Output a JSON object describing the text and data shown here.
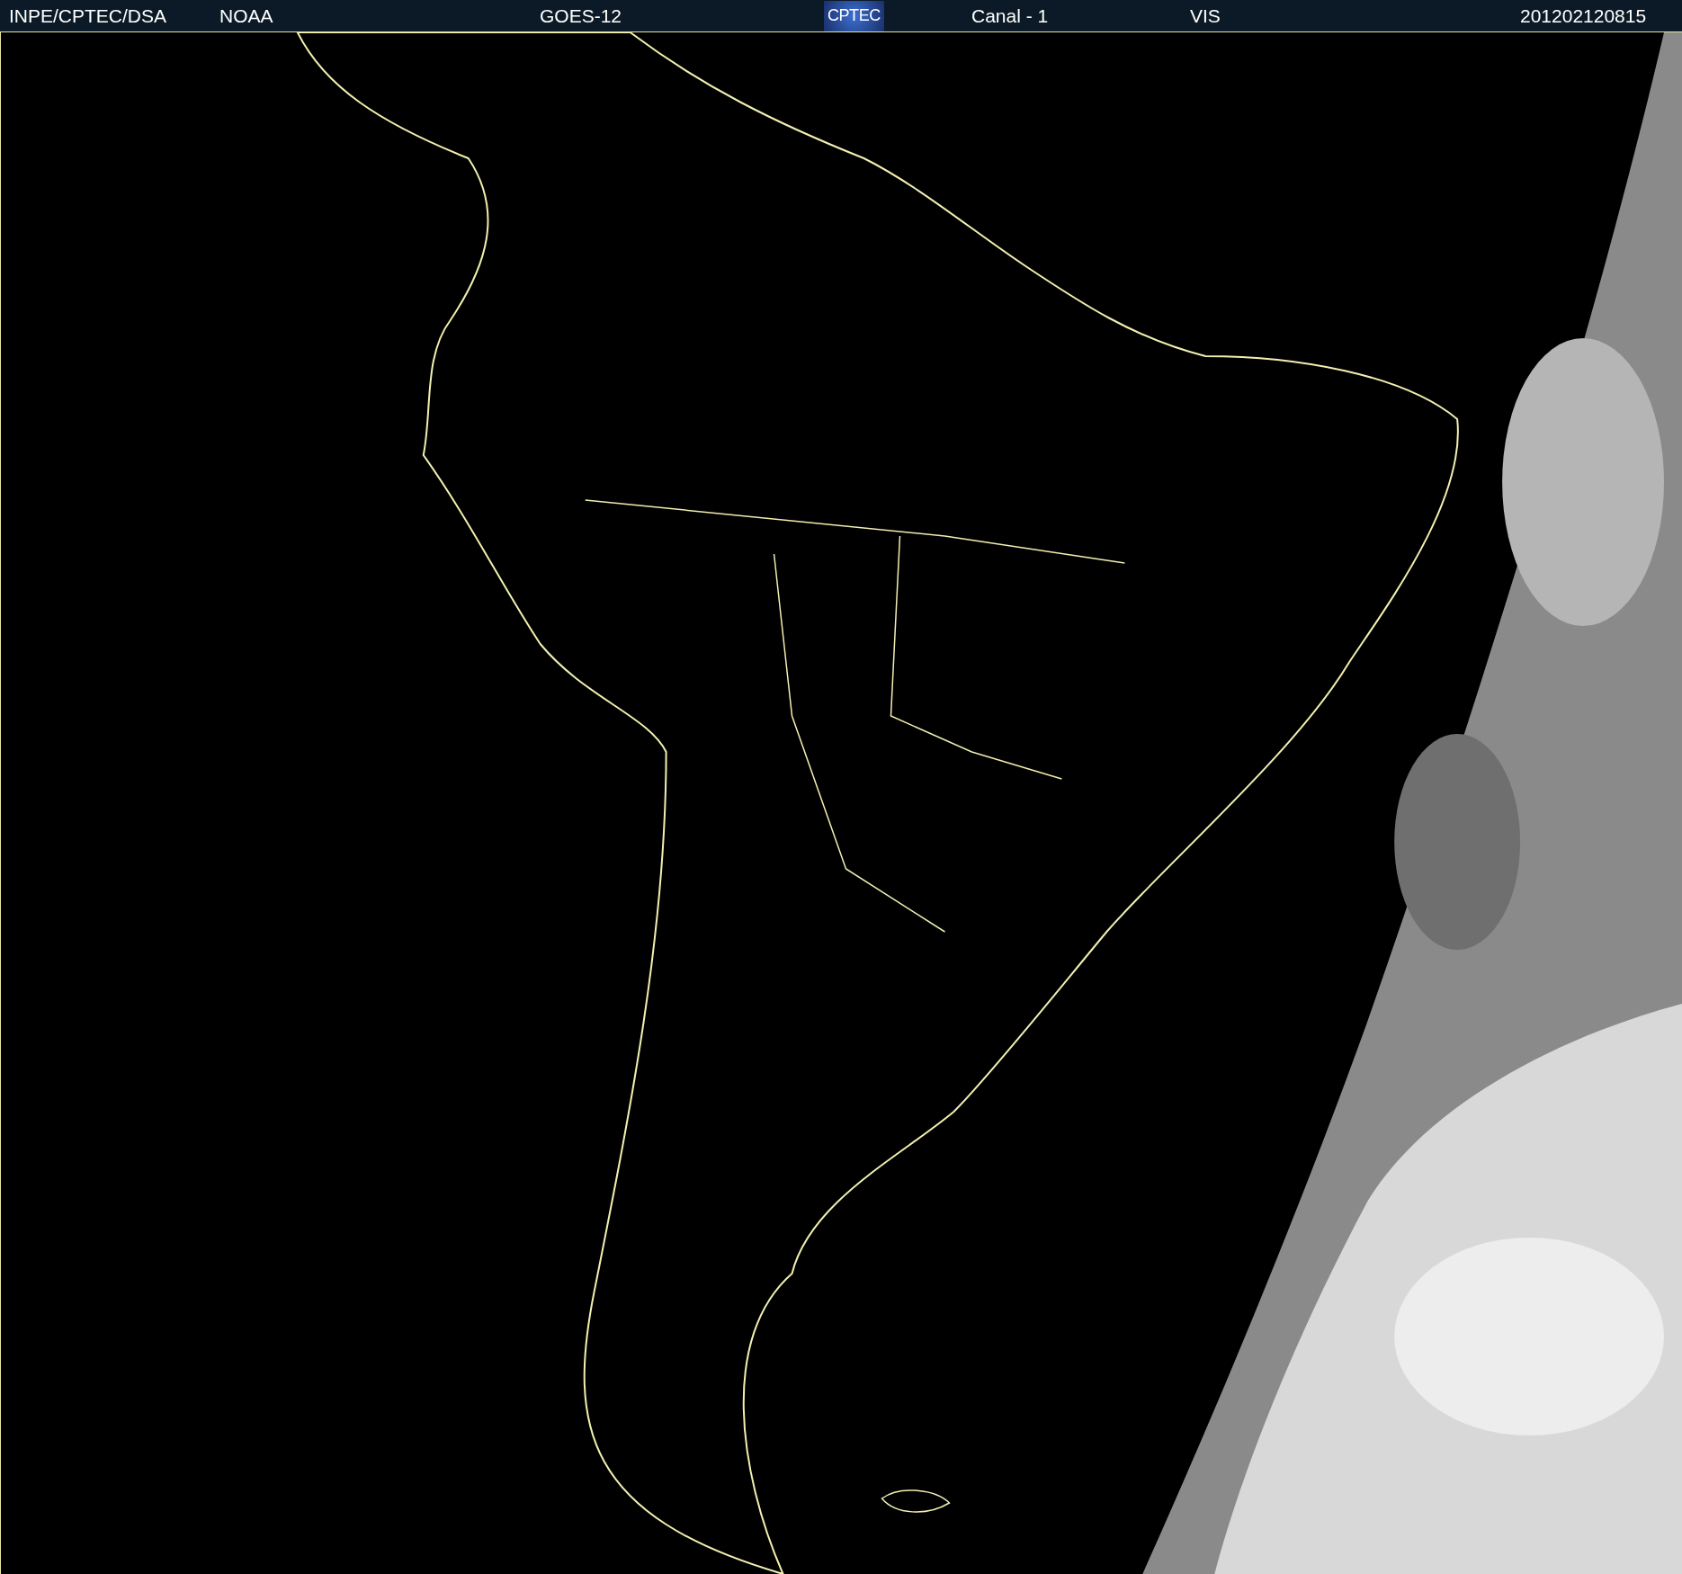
{
  "header": {
    "items": [
      {
        "kind": "text",
        "text": "INPE/CPTEC/DSA"
      },
      {
        "kind": "text",
        "text": "NOAA"
      },
      {
        "kind": "text",
        "text": "GOES-12"
      },
      {
        "kind": "logo",
        "text": "CPTEC"
      },
      {
        "kind": "text",
        "text": "Canal - 1"
      },
      {
        "kind": "text",
        "text": "VIS"
      },
      {
        "kind": "text",
        "text": "201202120815"
      }
    ]
  }
}
